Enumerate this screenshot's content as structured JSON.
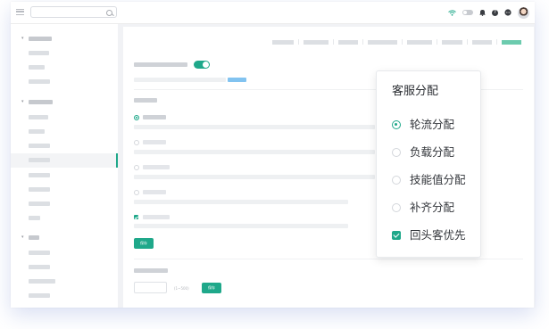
{
  "popup": {
    "title": "客服分配",
    "options": [
      {
        "label": "轮流分配",
        "type": "radio",
        "checked": true
      },
      {
        "label": "负载分配",
        "type": "radio",
        "checked": false
      },
      {
        "label": "技能值分配",
        "type": "radio",
        "checked": false
      },
      {
        "label": "补齐分配",
        "type": "radio",
        "checked": false
      },
      {
        "label": "回头客优先",
        "type": "checkbox",
        "checked": true
      }
    ]
  },
  "main": {
    "save_label": "保存",
    "range_hint": "(1~500)",
    "toggle_enabled": true
  },
  "colors": {
    "accent": "#1fa88a",
    "link": "#82c3f0",
    "window_bg": "#f1f2f5"
  },
  "icons": [
    "menu-icon",
    "search-icon",
    "wifi-icon",
    "toggle-icon",
    "bell-icon",
    "help-icon",
    "chat-icon",
    "avatar"
  ]
}
